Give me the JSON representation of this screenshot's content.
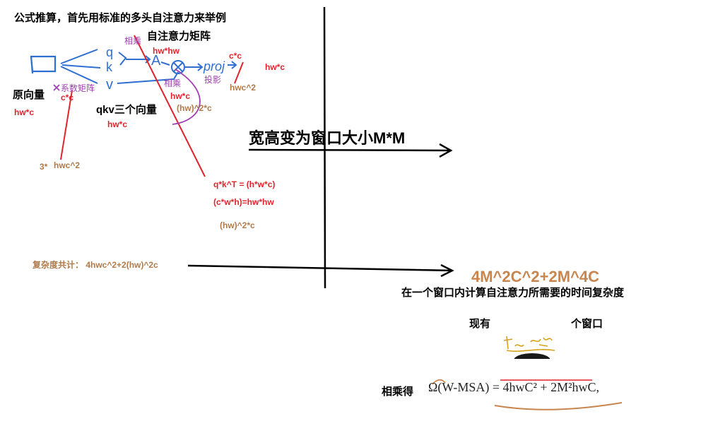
{
  "colors": {
    "blue": "#2f6fd1",
    "red": "#e0242c",
    "purple": "#a040b0",
    "brown": "#b07a4a",
    "black": "#000000",
    "orange_brown": "#c8864e"
  },
  "title": "公式推算，首先用标准的多头自注意力来举例",
  "self_attention_matrix": "自注意力矩阵",
  "label_multiply_top": "相乘",
  "label_hwhw": "hw*hw",
  "label_cc": "c*c",
  "label_hwc_right": "hw*c",
  "label_multiply_mid": "相乘",
  "label_projection": "投影",
  "label_hwc_sq_right": "hwc^2",
  "label_original_vector": "原向量",
  "label_coef_matrix": "系数矩阵",
  "label_cc_small": "c*c",
  "label_hwc_left": "hw*c",
  "label_hwc_mid": "hw*c",
  "label_qkv": "qkv三个向量",
  "label_hw2c_top": "(hw)^2*c",
  "label_hwc_qkv": "hw*c",
  "label_3": "3*",
  "label_hwc_sq_left": "hwc^2",
  "label_qkt_1": "q*k^T = (h*w*c)",
  "label_qkt_2": "(c*w*h)=hw*hw",
  "label_hw2c_bottom": "(hw)^2*c",
  "label_total": "复杂度共计：  4hwc^2+2(hw)^2c",
  "label_window": "宽高变为窗口大小M*M",
  "result_formula": "4M^2C^2+2M^4C",
  "result_caption": "在一个窗口内计算自注意力所需要的时间复杂度",
  "label_now": "现有",
  "label_windows": "个窗口",
  "label_multiply_get": "相乘得",
  "formula_omega": "Ω(W-MSA) = 4hwC² + 2M²hwC,",
  "sketch_letters": {
    "q": "q",
    "k": "k",
    "v": "v",
    "A": "A",
    "proj": "proj"
  }
}
